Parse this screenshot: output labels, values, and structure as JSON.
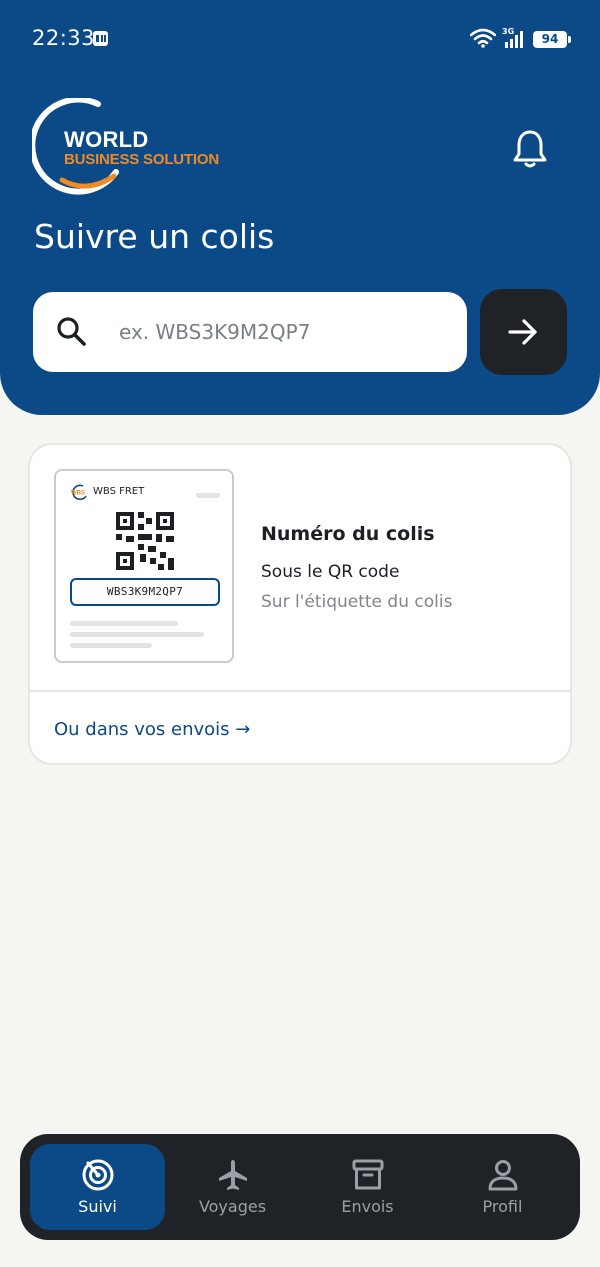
{
  "status_bar": {
    "time": "22:33",
    "network": "3G",
    "battery": "94"
  },
  "logo": {
    "line1": "WORLD",
    "line2": "BUSINESS SOLUTION"
  },
  "page_title": "Suivre un colis",
  "search": {
    "placeholder": "ex. WBS3K9M2QP7",
    "value": ""
  },
  "card": {
    "label_mock": {
      "brand_badge": "WBS",
      "brand": "WBS FRET",
      "code": "WBS3K9M2QP7"
    },
    "title": "Numéro du colis",
    "line1": "Sous le QR code",
    "line2": "Sur l'étiquette du colis",
    "link": "Ou dans vos envois →"
  },
  "nav": {
    "items": [
      {
        "label": "Suivi",
        "icon": "radar-icon",
        "active": true
      },
      {
        "label": "Voyages",
        "icon": "airplane-icon",
        "active": false
      },
      {
        "label": "Envois",
        "icon": "archive-box-icon",
        "active": false
      },
      {
        "label": "Profil",
        "icon": "user-icon",
        "active": false
      }
    ]
  },
  "colors": {
    "primary": "#0b4a87",
    "accent": "#f18a21",
    "dark": "#1f2328",
    "background": "#f5f5f2"
  }
}
